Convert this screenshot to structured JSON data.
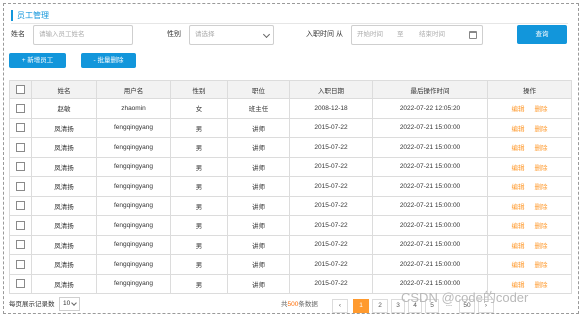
{
  "header": {
    "title": "员工管理"
  },
  "search": {
    "name_label": "姓名",
    "name_placeholder": "请输入员工姓名",
    "gender_label": "性别",
    "gender_placeholder": "请选择",
    "date_label": "入职时间",
    "date_from_label": "从",
    "start_placeholder": "开始时间",
    "to_label": "至",
    "end_placeholder": "结束时间",
    "query_label": "查询"
  },
  "actions": {
    "add_label": "+ 新增员工",
    "batch_delete_label": "- 批量删除"
  },
  "table": {
    "columns": [
      "姓名",
      "用户名",
      "性别",
      "职位",
      "入职日期",
      "最后操作时间",
      "操作"
    ],
    "edit_label": "编辑",
    "delete_label": "删除",
    "rows": [
      [
        "赵敏",
        "zhaomin",
        "女",
        "班主任",
        "2008-12-18",
        "2022-07-22 12:05:20"
      ],
      [
        "凤清扬",
        "fengqingyang",
        "男",
        "讲师",
        "2015-07-22",
        "2022-07-21 15:00:00"
      ],
      [
        "凤清扬",
        "fengqingyang",
        "男",
        "讲师",
        "2015-07-22",
        "2022-07-21 15:00:00"
      ],
      [
        "凤清扬",
        "fengqingyang",
        "男",
        "讲师",
        "2015-07-22",
        "2022-07-21 15:00:00"
      ],
      [
        "凤清扬",
        "fengqingyang",
        "男",
        "讲师",
        "2015-07-22",
        "2022-07-21 15:00:00"
      ],
      [
        "凤清扬",
        "fengqingyang",
        "男",
        "讲师",
        "2015-07-22",
        "2022-07-21 15:00:00"
      ],
      [
        "凤清扬",
        "fengqingyang",
        "男",
        "讲师",
        "2015-07-22",
        "2022-07-21 15:00:00"
      ],
      [
        "凤清扬",
        "fengqingyang",
        "男",
        "讲师",
        "2015-07-22",
        "2022-07-21 15:00:00"
      ],
      [
        "凤清扬",
        "fengqingyang",
        "男",
        "讲师",
        "2015-07-22",
        "2022-07-21 15:00:00"
      ],
      [
        "凤清扬",
        "fengqingyang",
        "男",
        "讲师",
        "2015-07-22",
        "2022-07-21 15:00:00"
      ]
    ]
  },
  "footer": {
    "page_size_label": "每页展示记录数",
    "page_size_value": "10",
    "total_prefix": "共",
    "total_count": "500",
    "total_suffix": "条数据",
    "prev": "‹",
    "pages": [
      "1",
      "2",
      "3",
      "4",
      "5"
    ],
    "ellipsis": "…",
    "last_page": "50",
    "next": "›"
  },
  "watermark": "CSDN @code的coder",
  "colors": {
    "primary": "#1296db",
    "accent": "#ff9a2e"
  }
}
